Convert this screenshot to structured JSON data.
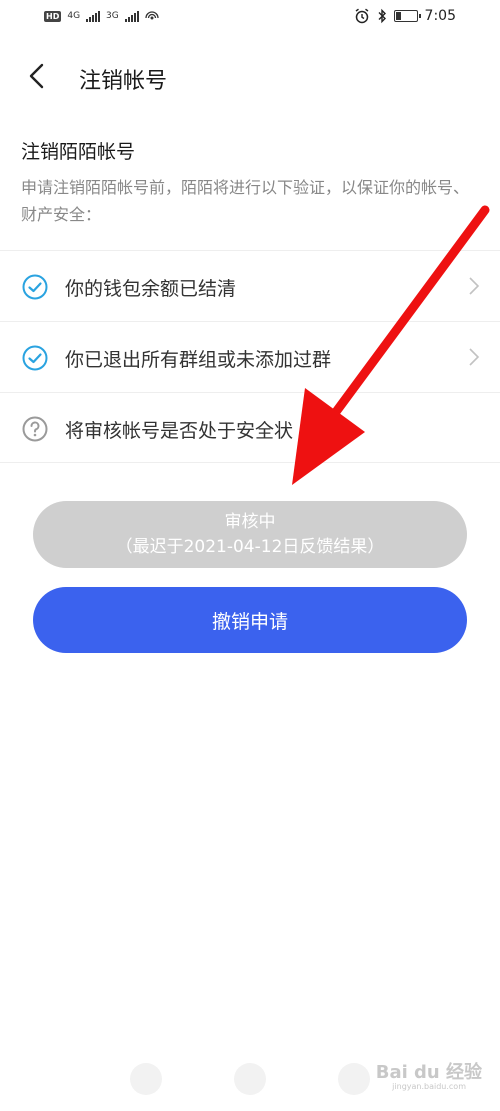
{
  "status_bar": {
    "network_left": "4G",
    "network_right": "3G",
    "time": "7:05"
  },
  "header": {
    "title": "注销帐号"
  },
  "intro": {
    "title": "注销陌陌帐号",
    "description": "申请注销陌陌帐号前，陌陌将进行以下验证，以保证你的帐号、财产安全："
  },
  "checks": [
    {
      "label": "你的钱包余额已结清",
      "status": "passed",
      "icon": "check-circle-icon",
      "has_arrow": true
    },
    {
      "label": "你已退出所有群组或未添加过群",
      "status": "passed",
      "icon": "check-circle-icon",
      "has_arrow": true
    },
    {
      "label": "将审核帐号是否处于安全状",
      "status": "pending",
      "icon": "question-circle-icon",
      "has_arrow": false
    }
  ],
  "buttons": {
    "review_line1": "审核中",
    "review_line2": "（最迟于2021-04-12日反馈结果）",
    "cancel_label": "撤销申请"
  },
  "watermark": {
    "text": "Bai du 经验",
    "sub": "jingyan.baidu.com"
  },
  "colors": {
    "accent_blue": "#3b62ee",
    "check_blue": "#2aa3e0",
    "disabled_gray": "#cfcfcf",
    "annotation_red": "#ee1111"
  }
}
